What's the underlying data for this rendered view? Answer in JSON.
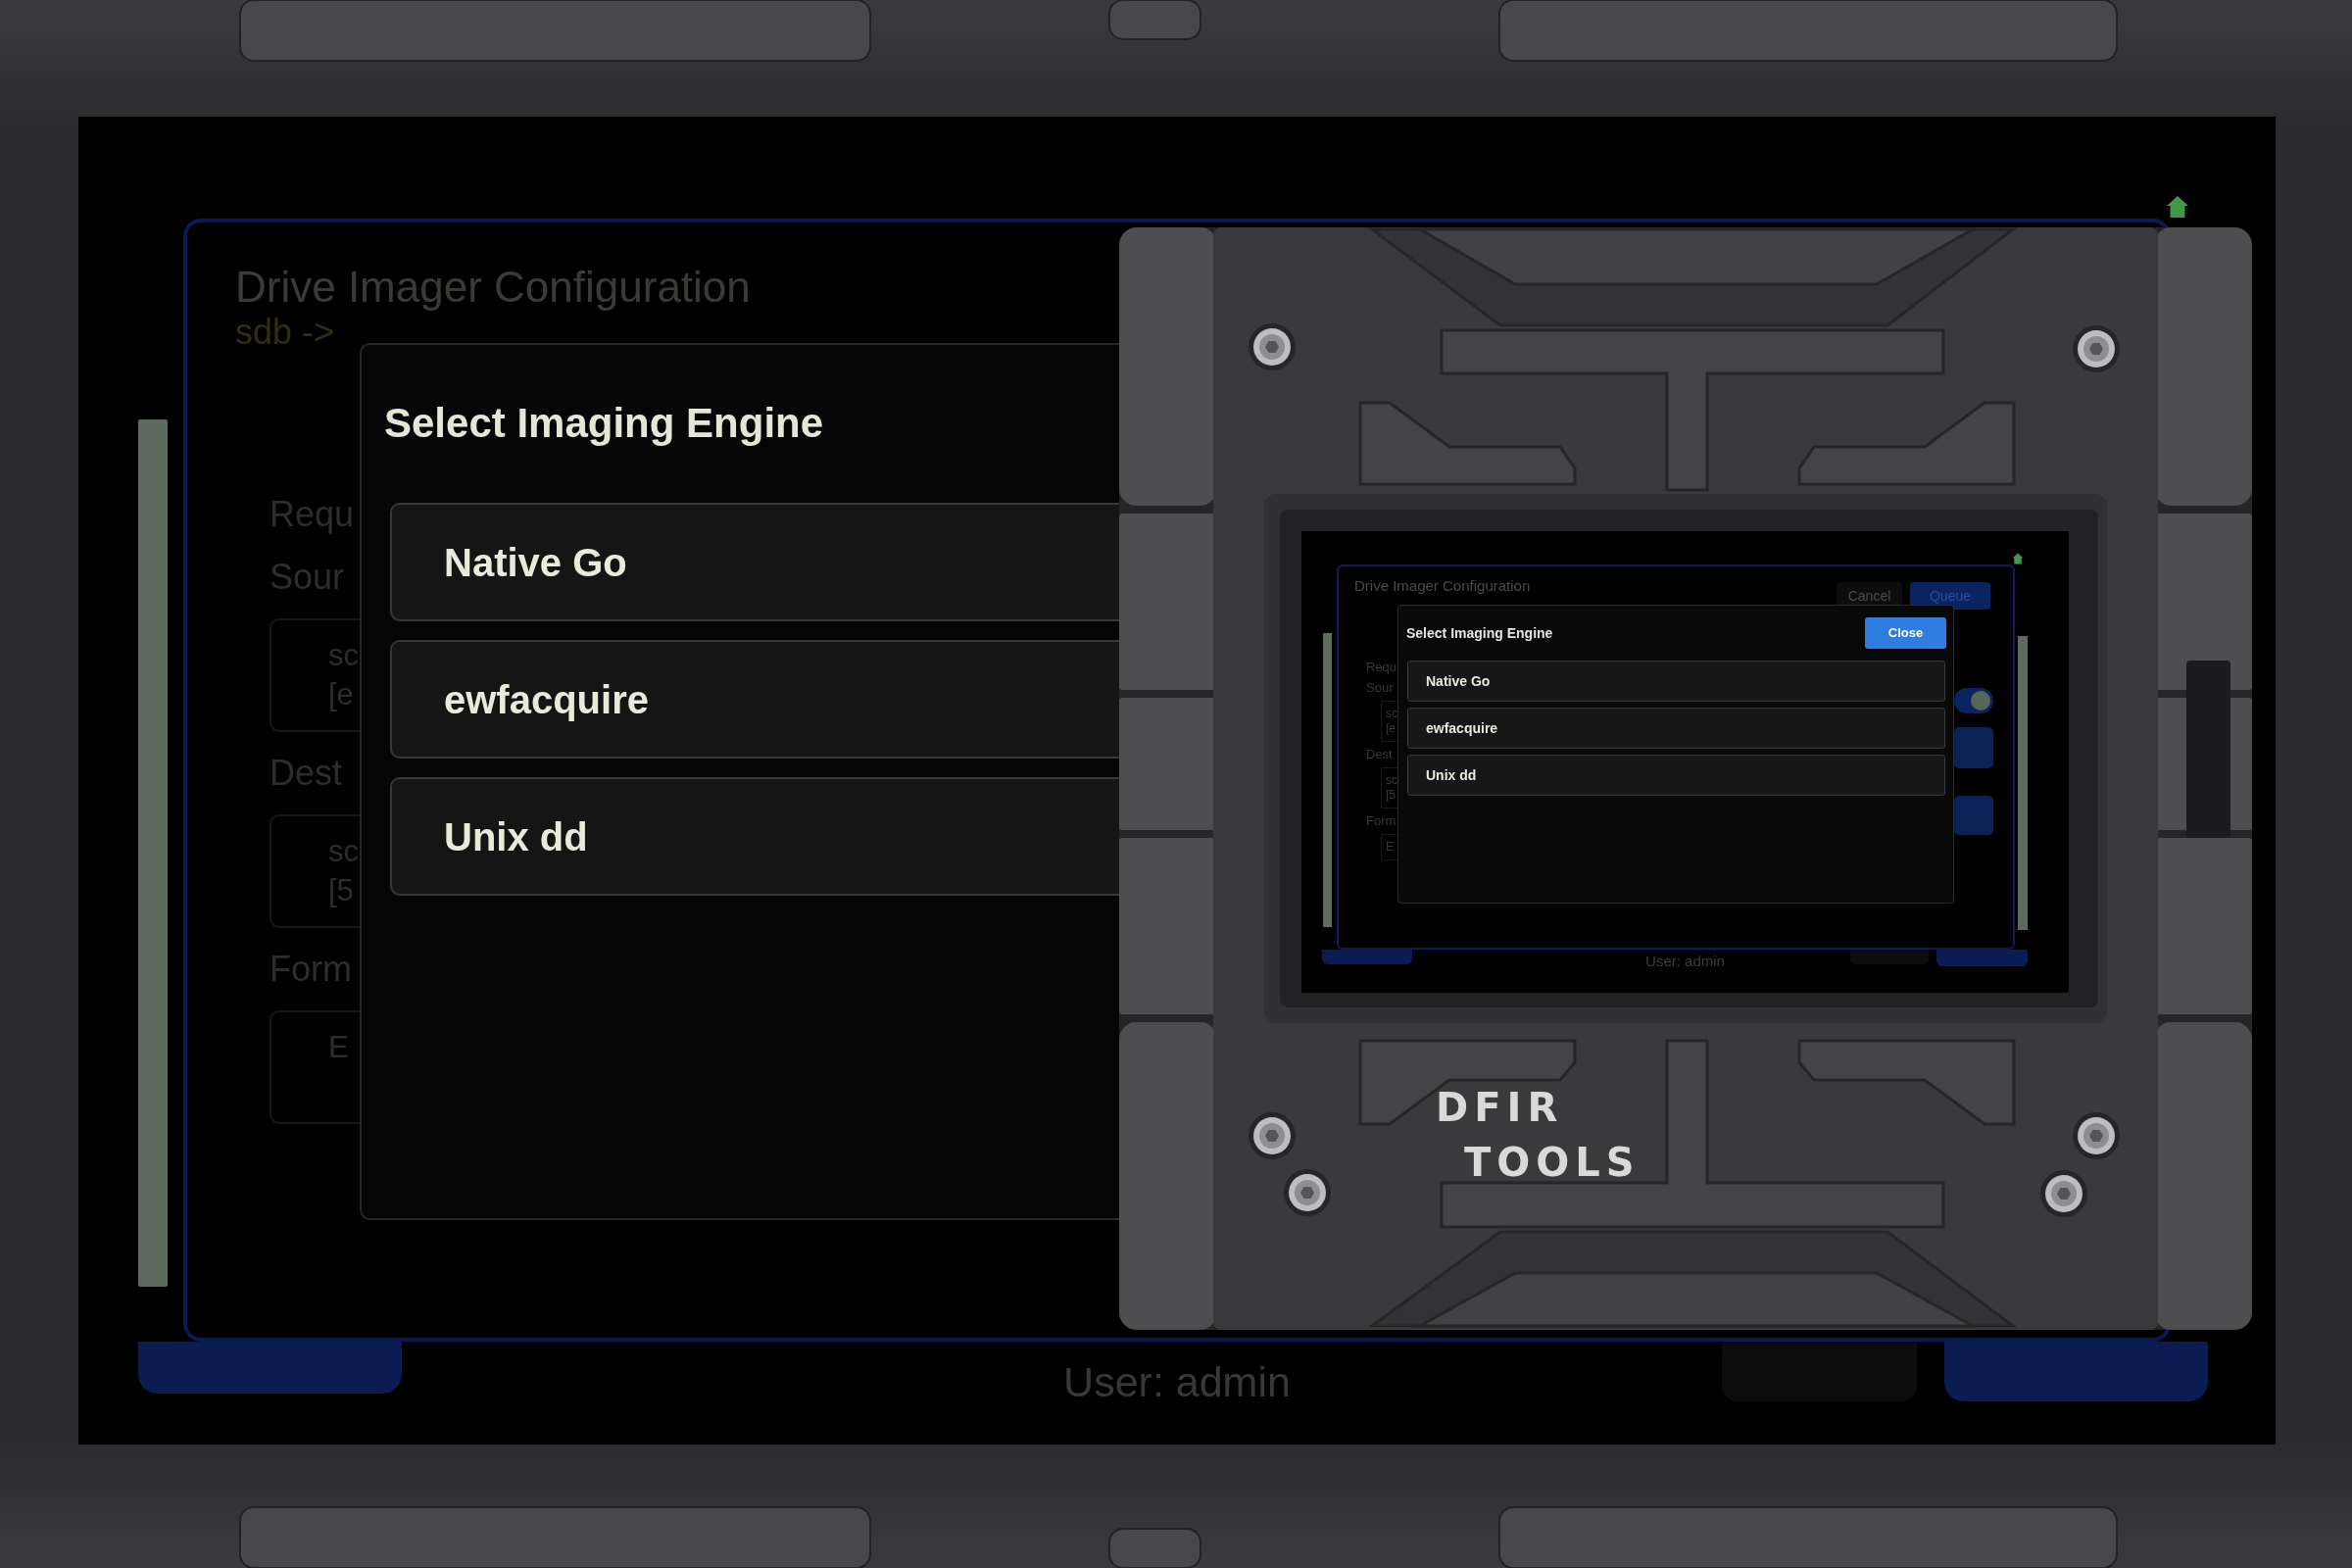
{
  "screen": {
    "card": {
      "title": "Drive Imager Configuration",
      "subtitle": "sdb ->",
      "form": [
        {
          "kind": "label",
          "text": "Requ"
        },
        {
          "kind": "label",
          "text": "Sour"
        },
        {
          "kind": "field",
          "lines": [
            "sc",
            "[e"
          ]
        },
        {
          "kind": "label",
          "text": "Dest"
        },
        {
          "kind": "field",
          "lines": [
            "sc",
            "[5"
          ]
        },
        {
          "kind": "label",
          "text": "Form"
        },
        {
          "kind": "field",
          "lines": [
            "E"
          ]
        }
      ]
    },
    "modal": {
      "title": "Select Imaging Engine",
      "options": [
        "Native Go",
        "ewfacquire",
        "Unix dd"
      ]
    },
    "footer": {
      "user": "User: admin"
    }
  },
  "device": {
    "logo": [
      "DFIR",
      "TOOLS"
    ],
    "screen": {
      "card": {
        "title": "Drive Imager Configuration",
        "buttons": [
          {
            "kind": "cancel",
            "label": "Cancel"
          },
          {
            "kind": "submit",
            "label": "Queue"
          }
        ],
        "form": [
          {
            "kind": "label",
            "text": "Requ"
          },
          {
            "kind": "label",
            "text": "Sour"
          },
          {
            "kind": "field",
            "lines": [
              "sc",
              "[e"
            ]
          },
          {
            "kind": "label",
            "text": "Dest"
          },
          {
            "kind": "field",
            "lines": [
              "sc",
              "[5"
            ]
          },
          {
            "kind": "label",
            "text": "Form"
          },
          {
            "kind": "field",
            "lines": [
              "E"
            ]
          }
        ],
        "side_controls": [
          {
            "kind": "toggle",
            "on": true
          },
          {
            "kind": "button"
          },
          {
            "kind": "button"
          }
        ]
      },
      "modal": {
        "title": "Select Imaging Engine",
        "close_label": "Close",
        "options": [
          "Native Go",
          "ewfacquire",
          "Unix dd"
        ]
      },
      "footer": {
        "user": "User: admin"
      }
    }
  }
}
